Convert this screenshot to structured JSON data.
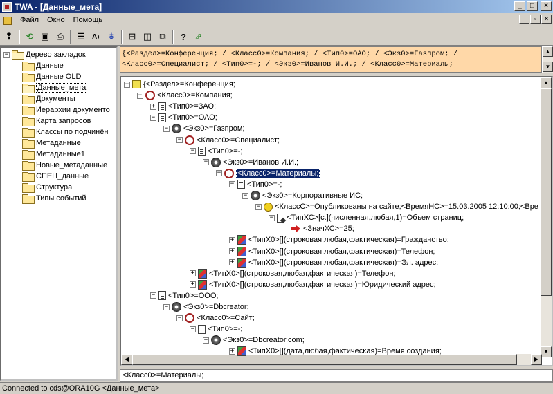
{
  "window": {
    "title": "TWA - [Данные_мета]"
  },
  "menu": [
    "Файл",
    "Окно",
    "Помощь"
  ],
  "toolbar": {
    "icons": [
      "help-pointer-icon",
      "refresh-icon",
      "save-icon",
      "print-icon",
      "list-icon",
      "font-size-icon",
      "sort-icon",
      "split-horizontal-icon",
      "split-vertical-icon",
      "window-icon",
      "help-icon",
      "export-icon"
    ]
  },
  "left_tree": {
    "root": "Дерево закладок",
    "items": [
      "Данные",
      "Данные OLD",
      "Данные_мета",
      "Документы",
      "Иерархии документо",
      "Карта запросов",
      "Классы по подчинён",
      "Метаданные",
      "Метаданные1",
      "Новые_метаданные",
      "СПЕЦ_данные",
      "Структура",
      "Типы событий"
    ],
    "selected": "Данные_мета"
  },
  "info_box": {
    "line1": "{<Раздел>=Конференция; / <Класс0>=Компания; / <Тип0>=ОАО; / <Экз0>=Газпром; /",
    "line2": "<Класс0>=Специалист; / <Тип0>=-; / <Экз0>=Иванов И.И.; / <Класс0>=Материалы;"
  },
  "right_tree": [
    {
      "icon": "section",
      "text": "{<Раздел>=Конференция;"
    },
    {
      "icon": "class",
      "text": "<Класс0>=Компания;"
    },
    {
      "icon": "type",
      "text": "<Тип0>=ЗАО;"
    },
    {
      "icon": "type",
      "text": "<Тип0>=ОАО;"
    },
    {
      "icon": "instance",
      "text": "<Экз0>=Газпром;"
    },
    {
      "icon": "class",
      "text": "<Класс0>=Специалист;"
    },
    {
      "icon": "type",
      "text": "<Тип0>=-;"
    },
    {
      "icon": "instance",
      "text": "<Экз0>=Иванов И.И.;"
    },
    {
      "icon": "class",
      "text": "<Класс0>=Материалы;"
    },
    {
      "icon": "type",
      "text": "<Тип0>=-;"
    },
    {
      "icon": "instance",
      "text": "<Экз0>=Корпоративные ИС;"
    },
    {
      "icon": "bulb",
      "text": "<КлассС>=Опубликованы на сайте;<ВремяНС>=15.03.2005 12:10:00;<Вре"
    },
    {
      "icon": "doc",
      "text": "<ТипХС>[с.](численная,любая,1)=Объем страниц;"
    },
    {
      "icon": "arrow",
      "text": "<ЗначХС>=25;"
    },
    {
      "icon": "gtype",
      "text": "<ТипХ0>[](строковая,любая,фактическая)=Гражданство;"
    },
    {
      "icon": "gtype",
      "text": "<ТипХ0>[](строковая,любая,фактическая)=Телефон;"
    },
    {
      "icon": "gtype",
      "text": "<ТипХ0>[](строковая,любая,фактическая)=Эл. адрес;"
    },
    {
      "icon": "gtype",
      "text": "<ТипХ0>[](строковая,любая,фактическая)=Телефон;"
    },
    {
      "icon": "gtype",
      "text": "<ТипХ0>[](строковая,любая,фактическая)=Юридический адрес;"
    },
    {
      "icon": "type",
      "text": "<Тип0>=ООО;"
    },
    {
      "icon": "instance",
      "text": "<Экз0>=Dbcreator;"
    },
    {
      "icon": "class",
      "text": "<Класс0>=Сайт;"
    },
    {
      "icon": "type",
      "text": "<Тип0>=-;"
    },
    {
      "icon": "instance",
      "text": "<Экз0>=Dbcreator.com;"
    },
    {
      "icon": "gtype",
      "text": "<ТипХ0>[](дата,любая,фактическая)=Время создания;"
    }
  ],
  "status_edit": "<Класс0>=Материалы;",
  "status": "Connected to cds@ORA10G <Данные_мета>"
}
